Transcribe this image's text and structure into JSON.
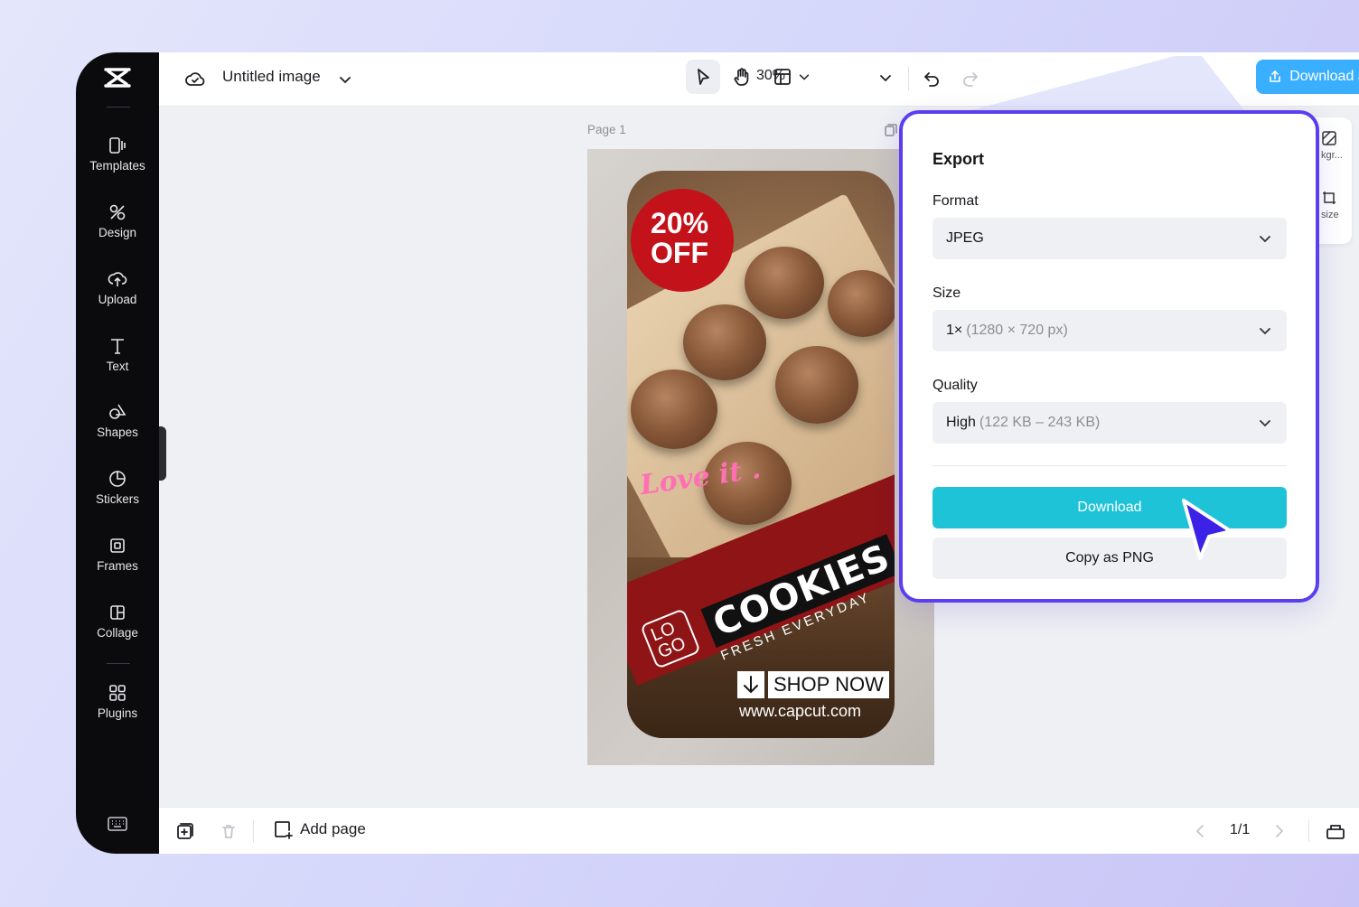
{
  "topbar": {
    "doc_title": "Untitled image",
    "zoom": "30%",
    "download_all": "Download all"
  },
  "sidebar": {
    "items": [
      {
        "label": "Templates",
        "icon": "templates-icon"
      },
      {
        "label": "Design",
        "icon": "design-icon"
      },
      {
        "label": "Upload",
        "icon": "upload-icon"
      },
      {
        "label": "Text",
        "icon": "text-icon"
      },
      {
        "label": "Shapes",
        "icon": "shapes-icon"
      },
      {
        "label": "Stickers",
        "icon": "stickers-icon"
      },
      {
        "label": "Frames",
        "icon": "frames-icon"
      },
      {
        "label": "Collage",
        "icon": "collage-icon"
      },
      {
        "label": "Plugins",
        "icon": "plugins-icon"
      }
    ]
  },
  "canvas": {
    "page_label": "Page 1",
    "design": {
      "badge_line1": "20%",
      "badge_line2": "OFF",
      "tagline": "Love it .",
      "headline": "COOKIES",
      "subhead": "FRESH EVERYDAY",
      "logo_line1": "LO",
      "logo_line2": "GO",
      "cta": "SHOP NOW",
      "url": "www.capcut.com"
    }
  },
  "mini_panel": {
    "item1": "kgr...",
    "item2": "size"
  },
  "export": {
    "title": "Export",
    "format_label": "Format",
    "format_value": "JPEG",
    "size_label": "Size",
    "size_value": "1×",
    "size_detail": "(1280 × 720 px)",
    "quality_label": "Quality",
    "quality_value": "High",
    "quality_detail": "(122 KB – 243 KB)",
    "download_button": "Download",
    "copy_button": "Copy as PNG"
  },
  "bottombar": {
    "add_page": "Add page",
    "pager": "1/1"
  },
  "colors": {
    "accent_blue": "#3aaeff",
    "download_cyan": "#1fc3d8",
    "highlight_border": "#5b3ef0",
    "rail_bg": "#0b0b0d"
  }
}
